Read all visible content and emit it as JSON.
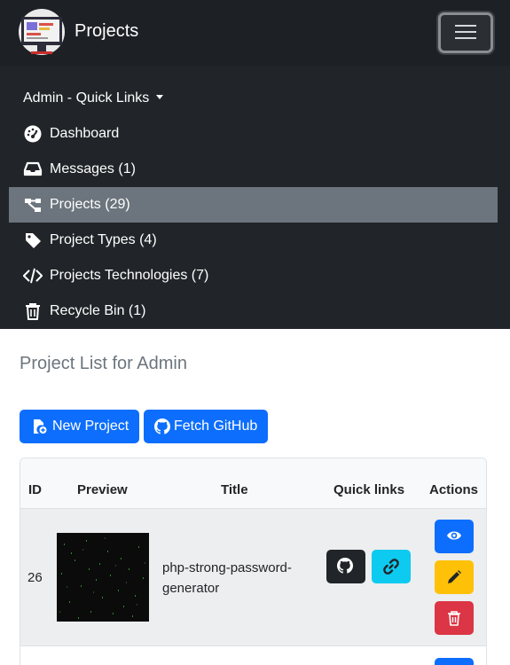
{
  "brand": {
    "title": "Projects"
  },
  "nav": {
    "dropdown_label": "Admin - Quick Links",
    "items": [
      {
        "label": "Dashboard",
        "icon": "dashboard-gauge-icon",
        "active": false
      },
      {
        "label": "Messages (1)",
        "icon": "inbox-icon",
        "active": false
      },
      {
        "label": "Projects (29)",
        "icon": "diagram-icon",
        "active": true
      },
      {
        "label": "Project Types (4)",
        "icon": "tag-icon",
        "active": false
      },
      {
        "label": "Projects Technologies (7)",
        "icon": "code-icon",
        "active": false
      },
      {
        "label": "Recycle Bin (1)",
        "icon": "trash-icon",
        "active": false
      }
    ]
  },
  "main": {
    "title": "Project List for Admin",
    "new_project_label": "New Project",
    "fetch_github_label": "Fetch GitHub"
  },
  "table": {
    "columns": [
      "ID",
      "Preview",
      "Title",
      "Quick links",
      "Actions"
    ],
    "rows": [
      {
        "id": "26",
        "title": "php-strong-password-generator"
      }
    ]
  },
  "colors": {
    "navbar": "#212529",
    "active_nav": "#6c757d",
    "primary": "#0d6efd",
    "info": "#0dcaf0",
    "warning": "#ffc107",
    "danger": "#dc3545",
    "dark": "#212529"
  }
}
